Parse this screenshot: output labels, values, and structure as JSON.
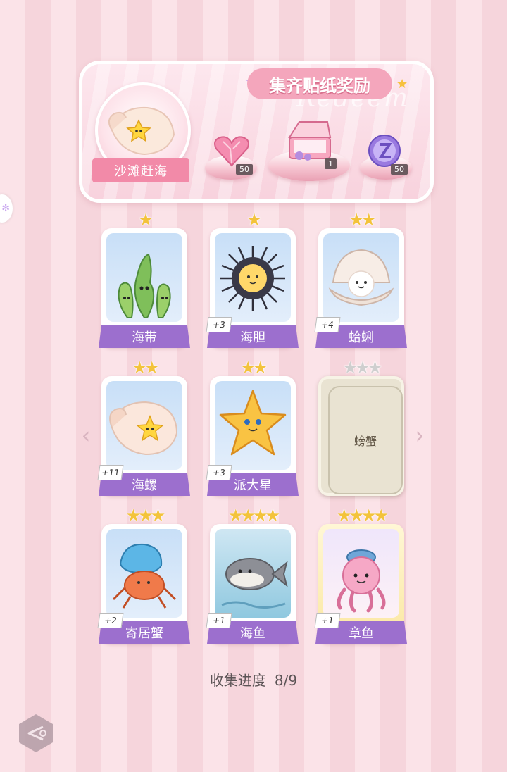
{
  "banner": {
    "title": "集齐贴纸奖励",
    "deco_text": "Redeem",
    "event_label": "沙滩赶海",
    "rewards": [
      {
        "icon": "pink-heart-gem-icon",
        "count": "50"
      },
      {
        "icon": "gift-box-icon",
        "count": "1"
      },
      {
        "icon": "purple-orb-icon",
        "count": "50"
      }
    ]
  },
  "cards": [
    {
      "name": "海带",
      "stars": 1,
      "max_stars": 1,
      "bonus": "",
      "locked": false,
      "art": "seaweed-icon"
    },
    {
      "name": "海胆",
      "stars": 1,
      "max_stars": 1,
      "bonus": "+3",
      "locked": false,
      "art": "sea-urchin-icon"
    },
    {
      "name": "蛤蜊",
      "stars": 2,
      "max_stars": 2,
      "bonus": "+4",
      "locked": false,
      "art": "clam-icon"
    },
    {
      "name": "海螺",
      "stars": 2,
      "max_stars": 2,
      "bonus": "+11",
      "locked": false,
      "art": "conch-icon"
    },
    {
      "name": "派大星",
      "stars": 2,
      "max_stars": 2,
      "bonus": "+3",
      "locked": false,
      "art": "starfish-icon"
    },
    {
      "name": "螃蟹",
      "stars": 0,
      "max_stars": 3,
      "bonus": "",
      "locked": true,
      "art": ""
    },
    {
      "name": "寄居蟹",
      "stars": 3,
      "max_stars": 3,
      "bonus": "+2",
      "locked": false,
      "art": "hermit-crab-icon"
    },
    {
      "name": "海鱼",
      "stars": 4,
      "max_stars": 4,
      "bonus": "+1",
      "locked": false,
      "art": "fish-icon"
    },
    {
      "name": "章鱼",
      "stars": 4,
      "max_stars": 4,
      "bonus": "+1",
      "locked": false,
      "art": "octopus-icon"
    }
  ],
  "progress": {
    "label": "收集进度",
    "value": "8/9"
  },
  "nav": {
    "prev_icon": "chevron-left-icon",
    "next_icon": "chevron-right-icon",
    "back_icon": "back-arrow-icon"
  }
}
